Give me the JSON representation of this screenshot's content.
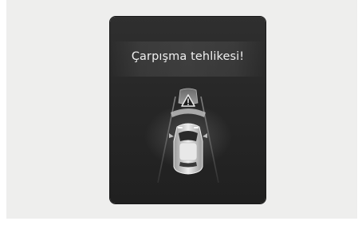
{
  "warning": {
    "message": "Çarpışma tehlikesi!",
    "icon": "collision-warning-icon"
  },
  "colors": {
    "background": "#eeeeed",
    "panel": "#272727",
    "text": "#f0f0f0",
    "lane": "#8a8a8a",
    "car": "#d9d9d9"
  }
}
